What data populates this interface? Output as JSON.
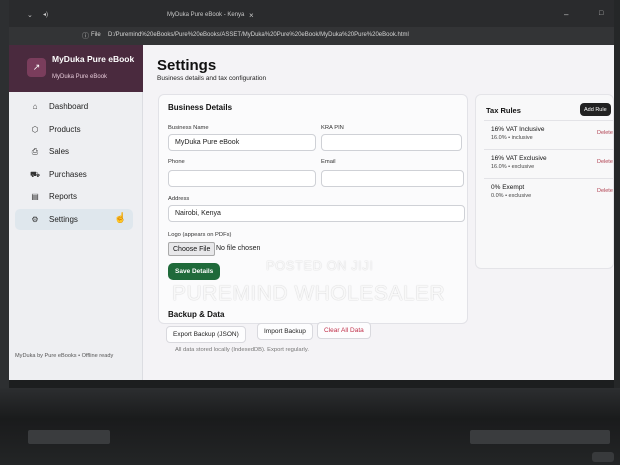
{
  "browser": {
    "tab_title": "MyDuka Pure eBook - Kenya",
    "address_label": "File",
    "url": "D:/Puremind%20eBooks/Pure%20eBooks/ASSET/MyDuka%20Pure%20eBook/MyDuka%20Pure%20eBook.html"
  },
  "sidebar": {
    "brand_name": "MyDuka Pure eBook",
    "brand_sub": "MyDuka Pure eBook",
    "items": [
      {
        "label": "Dashboard",
        "icon": "home-icon"
      },
      {
        "label": "Products",
        "icon": "box-icon"
      },
      {
        "label": "Sales",
        "icon": "bag-icon"
      },
      {
        "label": "Purchases",
        "icon": "truck-icon"
      },
      {
        "label": "Reports",
        "icon": "report-icon"
      },
      {
        "label": "Settings",
        "icon": "settings-icon",
        "active": true
      }
    ],
    "footer": "MyDuka by Pure eBooks • Offline ready"
  },
  "header": {
    "title": "Settings",
    "subtitle": "Business details and tax configuration"
  },
  "business": {
    "title": "Business Details",
    "name_label": "Business Name",
    "name_value": "MyDuka Pure eBook",
    "kra_label": "KRA PIN",
    "kra_value": "",
    "phone_label": "Phone",
    "phone_value": "",
    "email_label": "Email",
    "email_value": "",
    "address_label": "Address",
    "address_value": "Nairobi, Kenya",
    "logo_label": "Logo (appears on PDFs)",
    "choose_file": "Choose File",
    "no_file": "No file chosen",
    "save_label": "Save Details"
  },
  "tax_rules": {
    "title": "Tax Rules",
    "add_label": "Add Rule",
    "delete_label": "Delete",
    "rules": [
      {
        "name": "16% VAT Inclusive",
        "meta": "16.0% • inclusive"
      },
      {
        "name": "16% VAT Exclusive",
        "meta": "16.0% • exclusive"
      },
      {
        "name": "0% Exempt",
        "meta": "0.0% • exclusive"
      }
    ]
  },
  "backup": {
    "title": "Backup & Data",
    "export_label": "Export Backup (JSON)",
    "import_label": "Import Backup",
    "clear_label": "Clear All Data",
    "note": "All data stored locally (IndexedDB). Export regularly."
  },
  "watermark": {
    "line1": "POSTED ON JIJI",
    "line2": "PUREMIND WHOLESALER"
  },
  "colors": {
    "brand": "#4a2a3e",
    "save_button": "#1f6a3a",
    "danger": "#c0304a"
  }
}
